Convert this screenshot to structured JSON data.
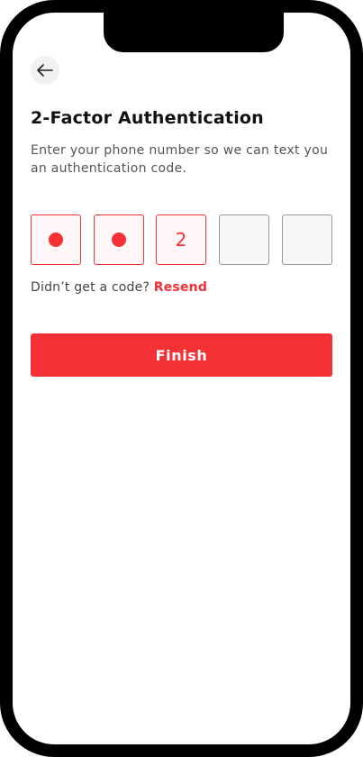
{
  "header": {
    "back_icon": "arrow-left-icon"
  },
  "main": {
    "title": "2-Factor Authentication",
    "subtitle": "Enter your phone number so we can text you an authentication code."
  },
  "code": {
    "length": 5,
    "digits": [
      {
        "state": "masked",
        "value": ""
      },
      {
        "state": "masked",
        "value": ""
      },
      {
        "state": "active",
        "value": "2"
      },
      {
        "state": "empty",
        "value": ""
      },
      {
        "state": "empty",
        "value": ""
      }
    ]
  },
  "resend": {
    "prompt": "Didn’t get a code?",
    "link_label": "Resend"
  },
  "actions": {
    "finish_label": "Finish"
  },
  "colors": {
    "accent": "#f43134",
    "text_primary": "#111111",
    "text_secondary": "#555555",
    "back_button_bg": "#f1f1f1"
  }
}
